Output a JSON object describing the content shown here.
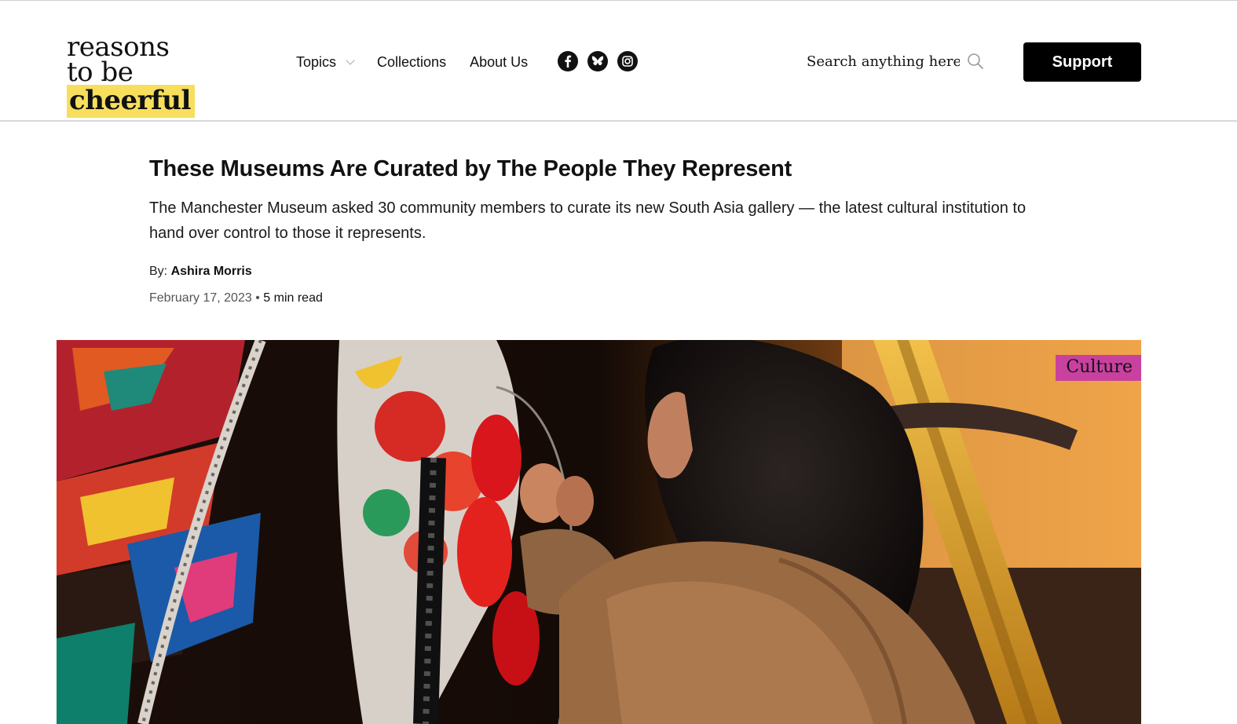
{
  "header": {
    "logo": {
      "line1": "reasons",
      "line2_plain": "to be",
      "line2_highlight": "cheerful"
    },
    "nav": [
      {
        "label": "Topics",
        "has_dropdown": true
      },
      {
        "label": "Collections"
      },
      {
        "label": "About Us"
      }
    ],
    "social": [
      "facebook-icon",
      "bluesky-icon",
      "instagram-icon"
    ],
    "search": {
      "placeholder": "Search anything here...",
      "icon": "search-icon"
    },
    "support_label": "Support"
  },
  "article": {
    "title": "These Museums Are Curated by The People They Represent",
    "subtitle": "The Manchester Museum asked 30 community members to curate its new South Asia gallery — the latest cultural institution to hand over control to those it represents.",
    "byline_prefix": "By:",
    "author": "Ashira Morris",
    "date": "February 17, 2023",
    "separator": "•",
    "read_time": "5 min read",
    "category_tag": "Culture"
  },
  "colors": {
    "logo_highlight": "#f7df5d",
    "tag_background": "#c8419f",
    "button_background": "#000000"
  }
}
